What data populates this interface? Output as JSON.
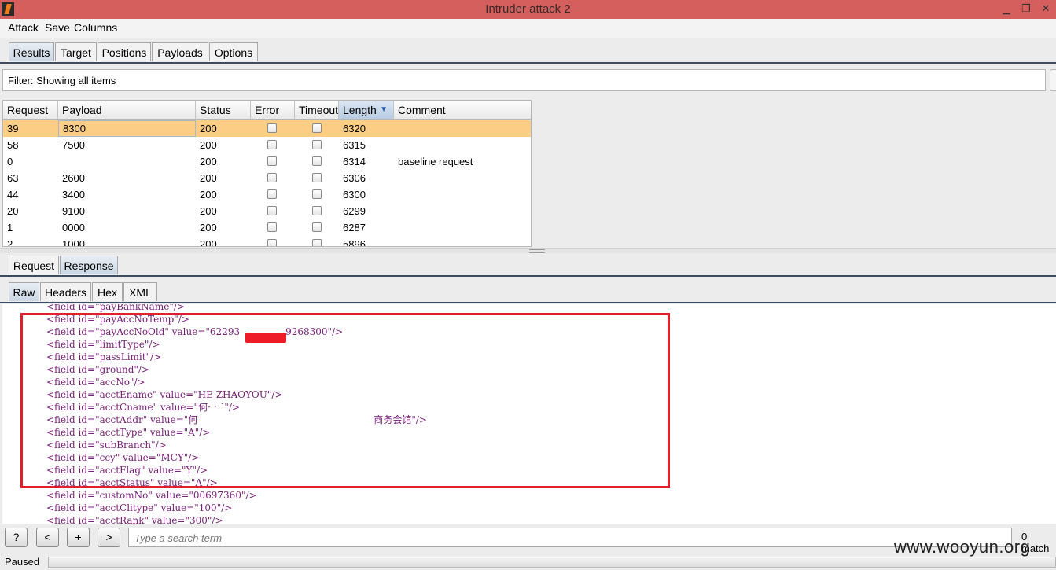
{
  "window": {
    "title": "Intruder attack 2"
  },
  "menu": [
    "Attack",
    "Save",
    "Columns"
  ],
  "main_tabs": [
    "Results",
    "Target",
    "Positions",
    "Payloads",
    "Options"
  ],
  "filter": {
    "text": "Filter: Showing all items"
  },
  "table": {
    "columns": [
      "Request",
      "Payload",
      "Status",
      "Error",
      "Timeout",
      "Length",
      "Comment"
    ],
    "sorted_column": "Length",
    "rows": [
      {
        "request": "39",
        "payload": "8300",
        "status": "200",
        "error": false,
        "timeout": false,
        "length": "6320",
        "comment": ""
      },
      {
        "request": "58",
        "payload": "7500",
        "status": "200",
        "error": false,
        "timeout": false,
        "length": "6315",
        "comment": ""
      },
      {
        "request": "0",
        "payload": "",
        "status": "200",
        "error": false,
        "timeout": false,
        "length": "6314",
        "comment": "baseline request"
      },
      {
        "request": "63",
        "payload": "2600",
        "status": "200",
        "error": false,
        "timeout": false,
        "length": "6306",
        "comment": ""
      },
      {
        "request": "44",
        "payload": "3400",
        "status": "200",
        "error": false,
        "timeout": false,
        "length": "6300",
        "comment": ""
      },
      {
        "request": "20",
        "payload": "9100",
        "status": "200",
        "error": false,
        "timeout": false,
        "length": "6299",
        "comment": ""
      },
      {
        "request": "1",
        "payload": "0000",
        "status": "200",
        "error": false,
        "timeout": false,
        "length": "6287",
        "comment": ""
      },
      {
        "request": "2",
        "payload": "1000",
        "status": "200",
        "error": false,
        "timeout": false,
        "length": "5896",
        "comment": ""
      }
    ],
    "selected_row": 0
  },
  "reqresp_tabs": [
    "Request",
    "Response"
  ],
  "view_tabs": [
    "Raw",
    "Headers",
    "Hex",
    "XML"
  ],
  "response_lines": [
    {
      "id": "payBankName",
      "value": null
    },
    {
      "id": "payAccNoTemp",
      "value": null
    },
    {
      "id": "payAccNoOld",
      "value": "62293",
      "value_tail": "9268300\"/>"
    },
    {
      "id": "limitType",
      "value": null
    },
    {
      "id": "passLimit",
      "value": null
    },
    {
      "id": "ground",
      "value": null
    },
    {
      "id": "accNo",
      "value": null
    },
    {
      "id": "acctEname",
      "value": "HE ZHAOYOU"
    },
    {
      "id": "acctCname",
      "value": "何· · ˙"
    },
    {
      "id": "acctAddr",
      "value": "何",
      "value_tail": "商务会馆\"/>"
    },
    {
      "id": "acctType",
      "value": "A"
    },
    {
      "id": "subBranch",
      "value": null
    },
    {
      "id": "ccy",
      "value": "MCY"
    },
    {
      "id": "acctFlag",
      "value": "Y"
    },
    {
      "id": "acctStatus",
      "value": "A"
    },
    {
      "id": "customNo",
      "value": "00697360"
    },
    {
      "id": "acctClitype",
      "value": "100"
    },
    {
      "id": "acctRank",
      "value": "300"
    }
  ],
  "search": {
    "placeholder": "Type a search term",
    "buttons": [
      "?",
      "<",
      "+",
      ">"
    ],
    "matches": "0 match"
  },
  "status": {
    "text": "Paused"
  },
  "watermark": "www.wooyun.org",
  "colors": {
    "titlebar": "#d45f5c",
    "selected_row": "#fccd85",
    "highlight_box": "#e0202a",
    "code_text": "#7a1f7a"
  }
}
